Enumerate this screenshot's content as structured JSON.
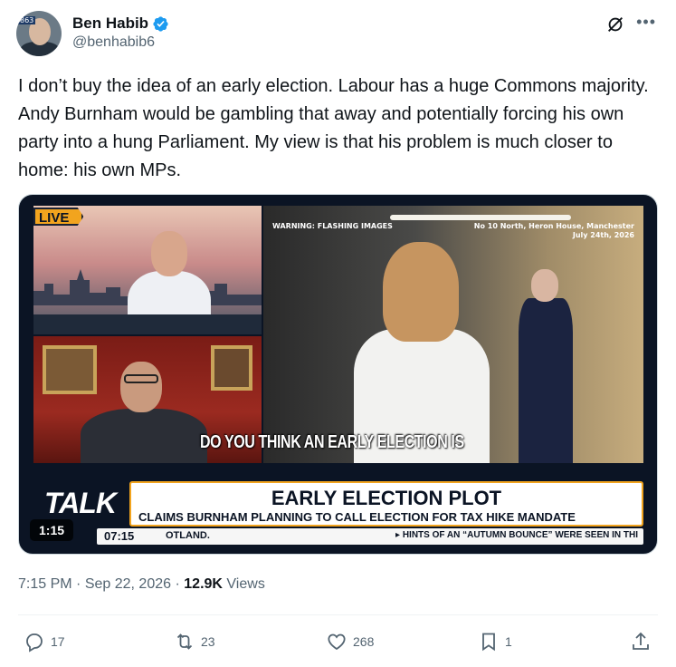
{
  "author": {
    "name": "Ben Habib",
    "handle": "@benhabib6",
    "avatar_badge": "863"
  },
  "tweet": {
    "text": "I don’t buy the idea of an early election. Labour has a huge Commons majority. Andy Burnham would be gambling that away and potentially forcing his own party into a hung Parliament. My view is that his problem is much closer to home: his own MPs."
  },
  "media": {
    "live_label": "LIVE",
    "warning": "WARNING: FLASHING IMAGES",
    "location_line1": "No 10 North, Heron House, Manchester",
    "location_line2": "July 24th, 2026",
    "subtitle": "DO YOU THINK AN EARLY ELECTION IS",
    "channel": "TALK",
    "headline": "EARLY ELECTION PLOT",
    "subheadline": "CLAIMS BURNHAM PLANNING TO CALL ELECTION FOR TAX HIKE MANDATE",
    "ticker_time": "07:15",
    "ticker_left": "OTLAND.",
    "ticker_right": "▸ HINTS OF AN “AUTUMN BOUNCE” WERE SEEN IN THI",
    "duration": "1:15"
  },
  "meta": {
    "time": "7:15 PM",
    "separator": "·",
    "date": "Sep 22, 2026",
    "views_count": "12.9K",
    "views_label": "Views"
  },
  "actions": {
    "replies": "17",
    "reposts": "23",
    "likes": "268",
    "bookmarks": "1"
  },
  "colors": {
    "accent_blue": "#1d9bf0",
    "secondary_text": "#536471",
    "talk_orange": "#f2a41e"
  }
}
